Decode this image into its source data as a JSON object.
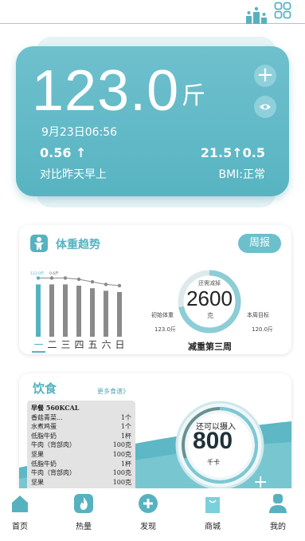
{
  "colors": {
    "accent": "#57b2c0",
    "hero": "#62b9c6",
    "bar": "#8a8a8a"
  },
  "header": {
    "icons": [
      "ranking-icon",
      "scan-icon"
    ]
  },
  "hero": {
    "weight": "123.0",
    "unit": "斤",
    "date": "9月23日06:56",
    "change_value": "0.56 ↑",
    "change_label": "对比昨天早上",
    "bmi_value": "21.5↑0.5",
    "bmi_label": "BMI:正常",
    "add_icon": "plus-icon",
    "visibility_icon": "eye-icon"
  },
  "trend": {
    "title": "体重趋势",
    "report_label": "周报",
    "days": [
      "一",
      "二",
      "三",
      "四",
      "五",
      "六",
      "日"
    ],
    "active_day": 0,
    "bar_levels": [
      0.92,
      0.92,
      0.92,
      0.9,
      0.86,
      0.82,
      0.8
    ],
    "bar_top_labels": [
      "123.0斤",
      "0.6斤"
    ],
    "ring_sub": "还需减掉",
    "ring_value": "2600",
    "ring_unit": "克",
    "ring_progress": 0.72,
    "init_label": "初始体重",
    "init_value": "123.0斤",
    "goal_label": "本周目标",
    "goal_value": "120.0斤",
    "week_label": "减重第三周"
  },
  "diet": {
    "title": "饮食",
    "more_label": "更多食谱》",
    "foods": [
      {
        "name": "早餐  560KCAL",
        "qty": ""
      },
      {
        "name": "香菇青菜...",
        "qty": "1个"
      },
      {
        "name": "水煮鸡蛋",
        "qty": "1个"
      },
      {
        "name": "低脂牛奶",
        "qty": "1杯"
      },
      {
        "name": "牛肉（背部肉）",
        "qty": "100克"
      },
      {
        "name": "坚果",
        "qty": "100克"
      },
      {
        "name": "低脂牛奶",
        "qty": "1杯"
      },
      {
        "name": "牛肉（背部肉）",
        "qty": "100克"
      },
      {
        "name": "坚果",
        "qty": "100克"
      }
    ],
    "intake_label": "还可以摄入",
    "intake_value": "800",
    "intake_unit": "千卡"
  },
  "nav": [
    {
      "label": "首页",
      "icon": "home-icon"
    },
    {
      "label": "热量",
      "icon": "calorie-flame-icon"
    },
    {
      "label": "发现",
      "icon": "discover-plus-icon"
    },
    {
      "label": "商城",
      "icon": "shop-bag-icon"
    },
    {
      "label": "我的",
      "icon": "profile-icon"
    }
  ]
}
